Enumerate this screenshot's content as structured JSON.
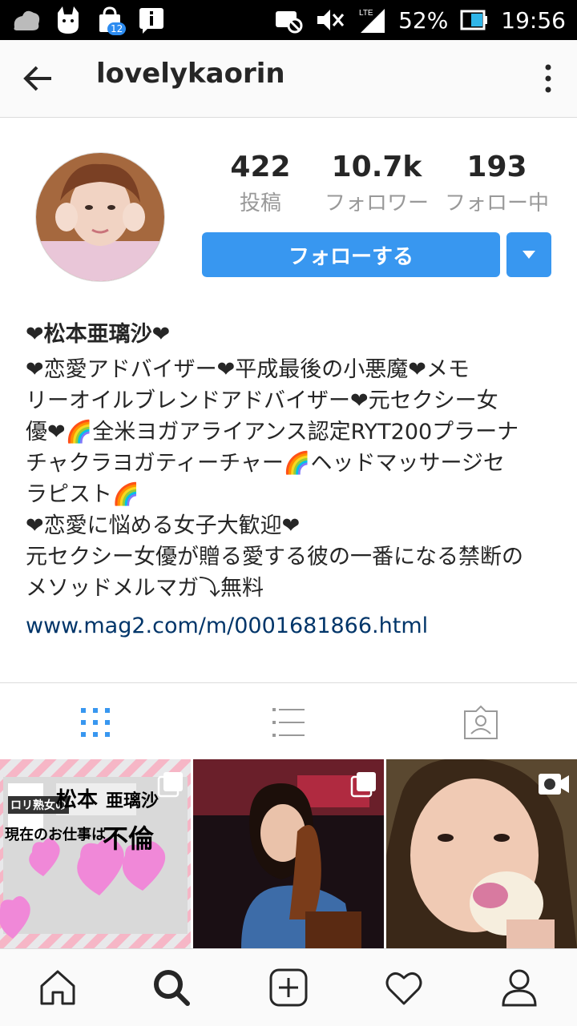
{
  "status_bar": {
    "battery": "52%",
    "time": "19:56",
    "mail_badge": "12"
  },
  "header": {
    "username": "lovelykaorin"
  },
  "stats": [
    {
      "number": "422",
      "label": "投稿"
    },
    {
      "number": "10.7k",
      "label": "フォロワー"
    },
    {
      "number": "193",
      "label": "フォロー中"
    }
  ],
  "follow_button": "フォローする",
  "bio": {
    "name": "❤松本亜璃沙❤",
    "lines": [
      "❤恋愛アドバイザー❤平成最後の小悪魔❤メモ",
      "リーオイルブレンドアドバイザー❤元セクシー女",
      "優❤🌈全米ヨガアライアンス認定RYT200プラーナ",
      "チャクラヨガティーチャー🌈ヘッドマッサージセ",
      "ラピスト🌈",
      "❤恋愛に悩める女子大歓迎❤",
      "元セクシー女優が贈る愛する彼の一番になる禁断の",
      "メソッドメルマガ⤵無料"
    ],
    "link": "www.mag2.com/m/0001681866.html"
  },
  "icons": {
    "back": "arrow-left-icon",
    "more": "more-vertical-icon",
    "grid": "grid-icon",
    "list": "list-icon",
    "tagged": "tagged-icon",
    "home": "home-icon",
    "search": "search-icon",
    "add": "add-icon",
    "heart": "heart-icon",
    "profile": "profile-icon"
  },
  "colors": {
    "accent": "#3897f0",
    "link": "#003569"
  },
  "grid_posts": [
    {
      "type": "carousel",
      "text_1": "ロリ熟女の",
      "text_2": "松本",
      "text_3": "亜璃沙",
      "text_4": "現在のお仕事は",
      "text_5": "不倫"
    },
    {
      "type": "carousel"
    },
    {
      "type": "video"
    }
  ]
}
